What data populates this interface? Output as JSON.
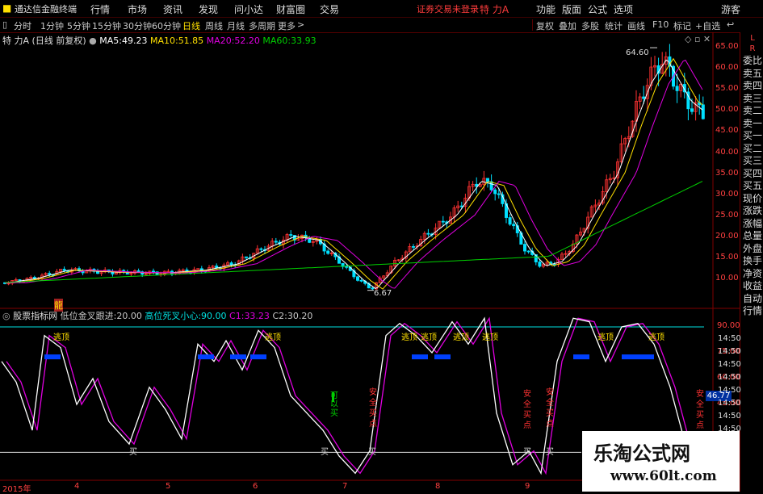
{
  "menubar": {
    "app_title": "通达信金融终端",
    "items": [
      "行情",
      "市场",
      "资讯",
      "发现",
      "问小达",
      "财富圈",
      "交易"
    ],
    "warning": "证券交易未登录",
    "stock": "特 力A",
    "right_items": [
      "功能",
      "版面",
      "公式",
      "选项"
    ],
    "guest": "游客"
  },
  "toolbar": {
    "periods": [
      "分时",
      "1分钟",
      "5分钟",
      "15分钟",
      "30分钟",
      "60分钟",
      "日线",
      "周线",
      "月线",
      "多周期",
      "更多"
    ],
    "active_period": "日线",
    "tools": [
      "复权",
      "叠加",
      "多股",
      "统计",
      "画线",
      "F10",
      "标记",
      "+自选",
      "↩"
    ]
  },
  "main_chart": {
    "title": "特 力A",
    "subtitle": "(日线 前复权)",
    "ma": [
      {
        "label": "MA5:",
        "value": "49.23",
        "color": "#ffffff"
      },
      {
        "label": "MA10:",
        "value": "51.85",
        "color": "#ffe000"
      },
      {
        "label": "MA20:",
        "value": "52.20",
        "color": "#e000e0"
      },
      {
        "label": "MA60:",
        "value": "33.93",
        "color": "#00d000"
      }
    ],
    "high_label": "64.60",
    "low_label": "6.67",
    "marker": "龍"
  },
  "indicator": {
    "name": "股票指标网",
    "params": [
      {
        "label": "低位金叉跟进:",
        "value": "20.00",
        "color": "#c8c8c8"
      },
      {
        "label": "高位死叉小心:",
        "value": "90.00",
        "color": "#00e0e0"
      },
      {
        "label": "C1:",
        "value": "33.23",
        "color": "#e000e0"
      },
      {
        "label": "C2:",
        "value": "30.20",
        "color": "#c8c8c8"
      }
    ],
    "current_value": "46.77",
    "signals": {
      "escape": "逃顶",
      "buy": "买",
      "safe_buy": "安全买点",
      "can_buy": "可以买"
    }
  },
  "y_axis_main": [
    "65.00",
    "60.00",
    "55.00",
    "50.00",
    "45.00",
    "40.00",
    "35.00",
    "30.00",
    "25.00",
    "20.00",
    "15.00",
    "10.00"
  ],
  "y_axis_ind": [
    "90.00",
    "75.00",
    "60.00",
    "45.00"
  ],
  "x_axis": [
    "2015年",
    "4",
    "5",
    "6",
    "7",
    "8",
    "9"
  ],
  "right_panel": {
    "top": "L",
    "top2": "R",
    "tabs": [
      "委比",
      "卖五",
      "卖四",
      "卖三",
      "卖二",
      "卖一",
      "买一",
      "买二",
      "买三",
      "买四",
      "买五",
      "现价",
      "涨跌",
      "涨幅",
      "总量",
      "外盘",
      "换手",
      "净资",
      "收益",
      "自动",
      "行情"
    ],
    "times": [
      "14:50",
      "14:50",
      "14:50",
      "14:50",
      "14:50",
      "14:50",
      "14:50",
      "14:50"
    ]
  },
  "watermark": {
    "title": "乐淘公式网",
    "url": "www.60lt.com"
  },
  "colors": {
    "up": "#ff3232",
    "down": "#00e0ff",
    "ma5": "#ffffff",
    "ma10": "#ffe000",
    "ma20": "#e000e0",
    "ma60": "#00d000",
    "axis": "#ff4040",
    "grid": "#500000",
    "cyan": "#00e0e0"
  }
}
